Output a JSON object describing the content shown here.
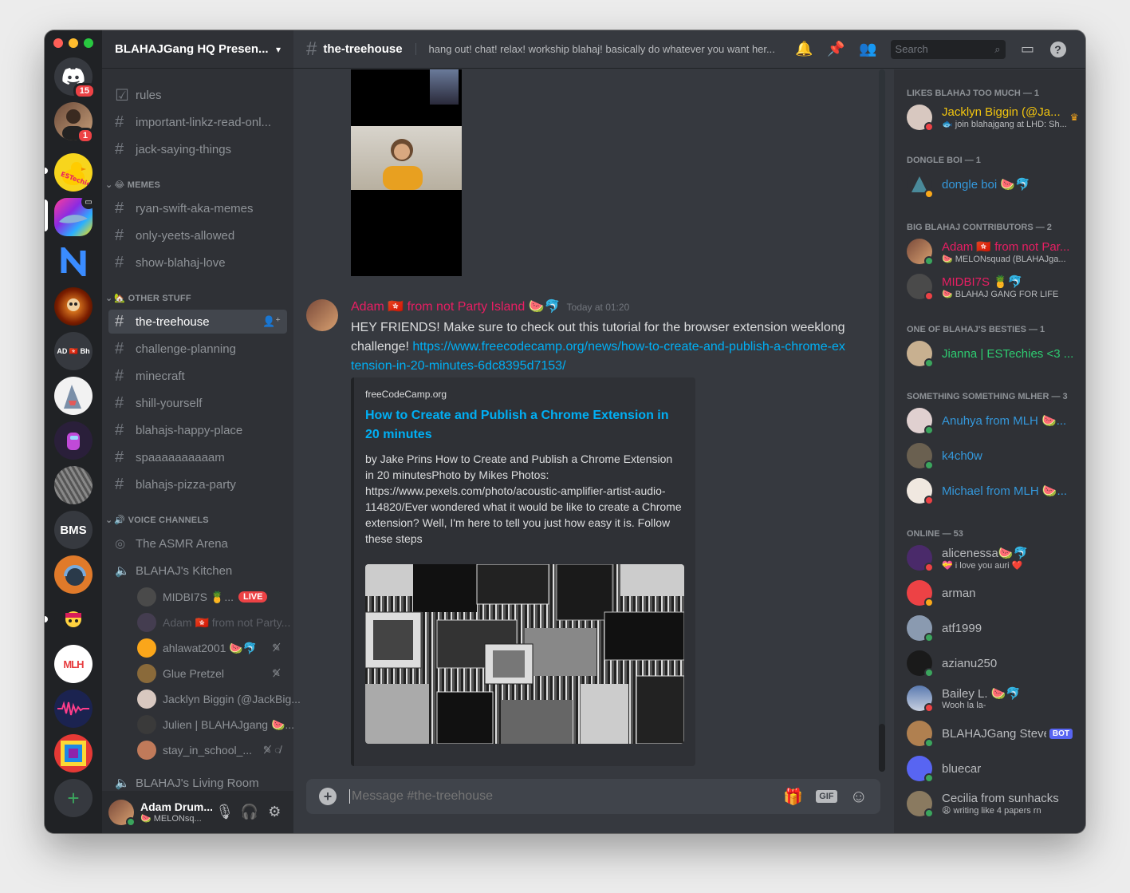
{
  "app": {
    "window_controls": [
      "close",
      "minimize",
      "maximize"
    ]
  },
  "guilds": {
    "home_badge": "15",
    "server2_badge": "1",
    "ad_label": "AD 🇭🇰 Bh",
    "bms_label": "BMS",
    "mlh_label": "MLH",
    "add_server": "+"
  },
  "server": {
    "name": "BLAHAJGang HQ Presen..."
  },
  "channels": {
    "top": [
      {
        "name": "rules",
        "icon": "rules-icon"
      },
      {
        "name": "important-linkz-read-onl...",
        "icon": "hash-icon"
      },
      {
        "name": "jack-saying-things",
        "icon": "hash-icon"
      }
    ],
    "cat_memes": "😂 MEMES",
    "memes": [
      "ryan-swift-aka-memes",
      "only-yeets-allowed",
      "show-blahaj-love"
    ],
    "cat_other": "🏡 OTHER STUFF",
    "other": [
      "the-treehouse",
      "challenge-planning",
      "minecraft",
      "shill-yourself",
      "blahajs-happy-place",
      "spaaaaaaaaaam",
      "blahajs-pizza-party"
    ],
    "cat_voice": "🔊 VOICE CHANNELS",
    "voice": [
      "The ASMR Arena",
      "BLAHAJ's Kitchen",
      "BLAHAJ's Living Room"
    ],
    "voice_users": [
      {
        "name": "MIDBI7S 🍍...",
        "live": "LIVE"
      },
      {
        "name": "Adam 🇭🇰 from not Party..."
      },
      {
        "name": "ahlawat2001 🍉🐬"
      },
      {
        "name": "Glue Pretzel"
      },
      {
        "name": "Jacklyn Biggin (@JackBig..."
      },
      {
        "name": "Julien | BLAHAJgang 🍉..."
      },
      {
        "name": "stay_in_school_..."
      }
    ]
  },
  "user_panel": {
    "name": "Adam Drum...",
    "status": "🍉 MELONsq..."
  },
  "topbar": {
    "channel": "the-treehouse",
    "topic": "hang out! chat! relax! workship blahaj! basically do whatever you want her...",
    "search_placeholder": "Search"
  },
  "message": {
    "author": "Adam 🇭🇰 from not Party Island 🍉🐬",
    "timestamp": "Today at 01:20",
    "text": "HEY FRIENDS! Make sure to check out this tutorial for the browser extension weeklong challenge!",
    "link": "https://www.freecodecamp.org/news/how-to-create-and-publish-a-chrome-extension-in-20-minutes-6dc8395d7153/",
    "embed": {
      "provider": "freeCodeCamp.org",
      "title": "How to Create and Publish a Chrome Extension in 20 minutes",
      "description": "by Jake Prins How to Create and Publish a Chrome Extension in 20 minutesPhoto by Mikes Photos: https://www.pexels.com/photo/acoustic-amplifier-artist-audio-114820/Ever wondered what it would be like to create a Chrome extension? Well, I'm here to tell you just how easy it is. Follow these steps"
    }
  },
  "composer": {
    "placeholder": "Message #the-treehouse",
    "gif": "GIF"
  },
  "members": {
    "groups": [
      {
        "title": "LIKES BLAHAJ TOO MUCH — 1",
        "users": [
          {
            "name": "Jacklyn Biggin (@Ja...",
            "sub": "🐟 join blahajgang at LHD: Sh...",
            "color": "#f1c40f"
          }
        ]
      },
      {
        "title": "DONGLE BOI — 1",
        "users": [
          {
            "name": "dongle boi 🍉🐬",
            "sub": "",
            "color": "#3498db"
          }
        ]
      },
      {
        "title": "BIG BLAHAJ CONTRIBUTORS — 2",
        "users": [
          {
            "name": "Adam 🇭🇰 from not Par...",
            "sub": "🍉 MELONsquad (BLAHAJga...",
            "color": "#e91e63"
          },
          {
            "name": "MIDBI7S 🍍🐬",
            "sub": "🍉 BLAHAJ GANG FOR LIFE",
            "color": "#e91e63"
          }
        ]
      },
      {
        "title": "ONE OF BLAHAJ'S BESTIES — 1",
        "users": [
          {
            "name": "Jianna | ESTechies <3 ...",
            "sub": "",
            "color": "#2ecc71"
          }
        ]
      },
      {
        "title": "SOMETHING SOMETHING MLHER — 3",
        "users": [
          {
            "name": "Anuhya from MLH 🍉...",
            "sub": "",
            "color": "#3498db"
          },
          {
            "name": "k4ch0w",
            "sub": "",
            "color": "#3498db"
          },
          {
            "name": "Michael from MLH 🍉...",
            "sub": "",
            "color": "#3498db"
          }
        ]
      },
      {
        "title": "ONLINE — 53",
        "users": [
          {
            "name": "alicenessa🍉🐬",
            "sub": "💝 i love you auri ❤️",
            "color": "#b9bbbe"
          },
          {
            "name": "arman",
            "sub": "",
            "color": "#b9bbbe"
          },
          {
            "name": "atf1999",
            "sub": "",
            "color": "#b9bbbe"
          },
          {
            "name": "azianu250",
            "sub": "",
            "color": "#b9bbbe"
          },
          {
            "name": "Bailey L. 🍉🐬",
            "sub": "Wooh la la-",
            "color": "#b9bbbe"
          },
          {
            "name": "BLAHAJGang Steve",
            "sub": "",
            "color": "#b9bbbe",
            "bot": "BOT"
          },
          {
            "name": "bluecar",
            "sub": "",
            "color": "#b9bbbe"
          },
          {
            "name": "Cecilia from sunhacks",
            "sub": "😩 writing like 4 papers rn",
            "color": "#b9bbbe"
          }
        ]
      }
    ]
  },
  "colors": {
    "blurple": "#5865f2",
    "link": "#00aff4",
    "online": "#3ba55d",
    "dnd": "#ed4245",
    "idle": "#faa81a"
  }
}
